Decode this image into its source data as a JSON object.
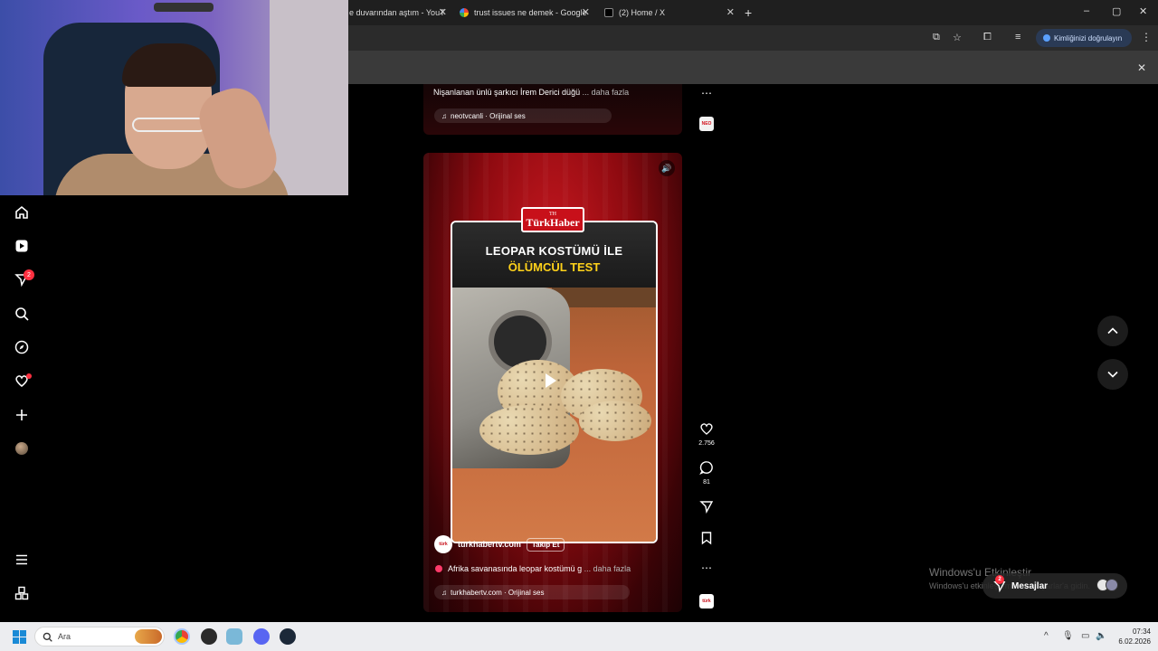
{
  "browser": {
    "tabs": [
      {
        "title": "e duvarından aştım - YouT"
      },
      {
        "title": "trust issues ne demek - Google"
      },
      {
        "title": "(2) Home / X"
      }
    ],
    "new_tab": "+",
    "window_controls": [
      "–",
      "▢",
      "✕"
    ],
    "verify_label": "Kimliğinizi doğrulayın",
    "close_glyph": "✕",
    "menu_glyph": "⋮"
  },
  "sidebar": {
    "notification_badge": "2",
    "items": [
      {
        "name": "home-icon",
        "glyph": "⌂"
      },
      {
        "name": "reels-icon",
        "glyph": "▶"
      },
      {
        "name": "messages-icon",
        "glyph": "◁"
      },
      {
        "name": "search-icon",
        "glyph": "⌕"
      },
      {
        "name": "explore-icon",
        "glyph": "◎"
      },
      {
        "name": "notifications-icon",
        "glyph": "♡"
      },
      {
        "name": "create-icon",
        "glyph": "+"
      },
      {
        "name": "more-icon",
        "glyph": "☰"
      },
      {
        "name": "also-from-meta-icon",
        "glyph": "⌂"
      }
    ]
  },
  "previous_post": {
    "caption": "Nişanlanan ünlü şarkıcı İrem Derici düğü",
    "more": "... daha fazla",
    "audio": "neotvcanli · Orijinal ses",
    "thumb_label": "NEO"
  },
  "reel": {
    "logo_small": "TH",
    "logo_name": "TürkHaber",
    "headline_line1": "LEOPAR KOSTÜMÜ İLE",
    "headline_line2": "ÖLÜMCÜL TEST",
    "author": "turkhabertv.com",
    "author_avatar": "türk",
    "follow_label": "Takip Et",
    "caption": "Afrika savanasında leopar kostümü g",
    "more": "... daha fazla",
    "audio": "turkhabertv.com · Orijinal ses",
    "likes": "2.756",
    "comments": "81",
    "thumb_label": "türk"
  },
  "overlay": {
    "watermark_line1": "Windows'u Etkinleştir",
    "watermark_line2": "Windows'u etkinleştirmek için Ayarlar'a gidin.",
    "messages_label": "Mesajlar",
    "messages_badge": "2"
  },
  "taskbar": {
    "search_placeholder": "Ara",
    "time": "07:34",
    "date": "6.02.2026"
  },
  "colors": {
    "accent_red": "#ff3040",
    "brand_red": "#c8101a",
    "headline_yellow": "#ffd21a",
    "verify_blue": "#5aa0ff"
  }
}
